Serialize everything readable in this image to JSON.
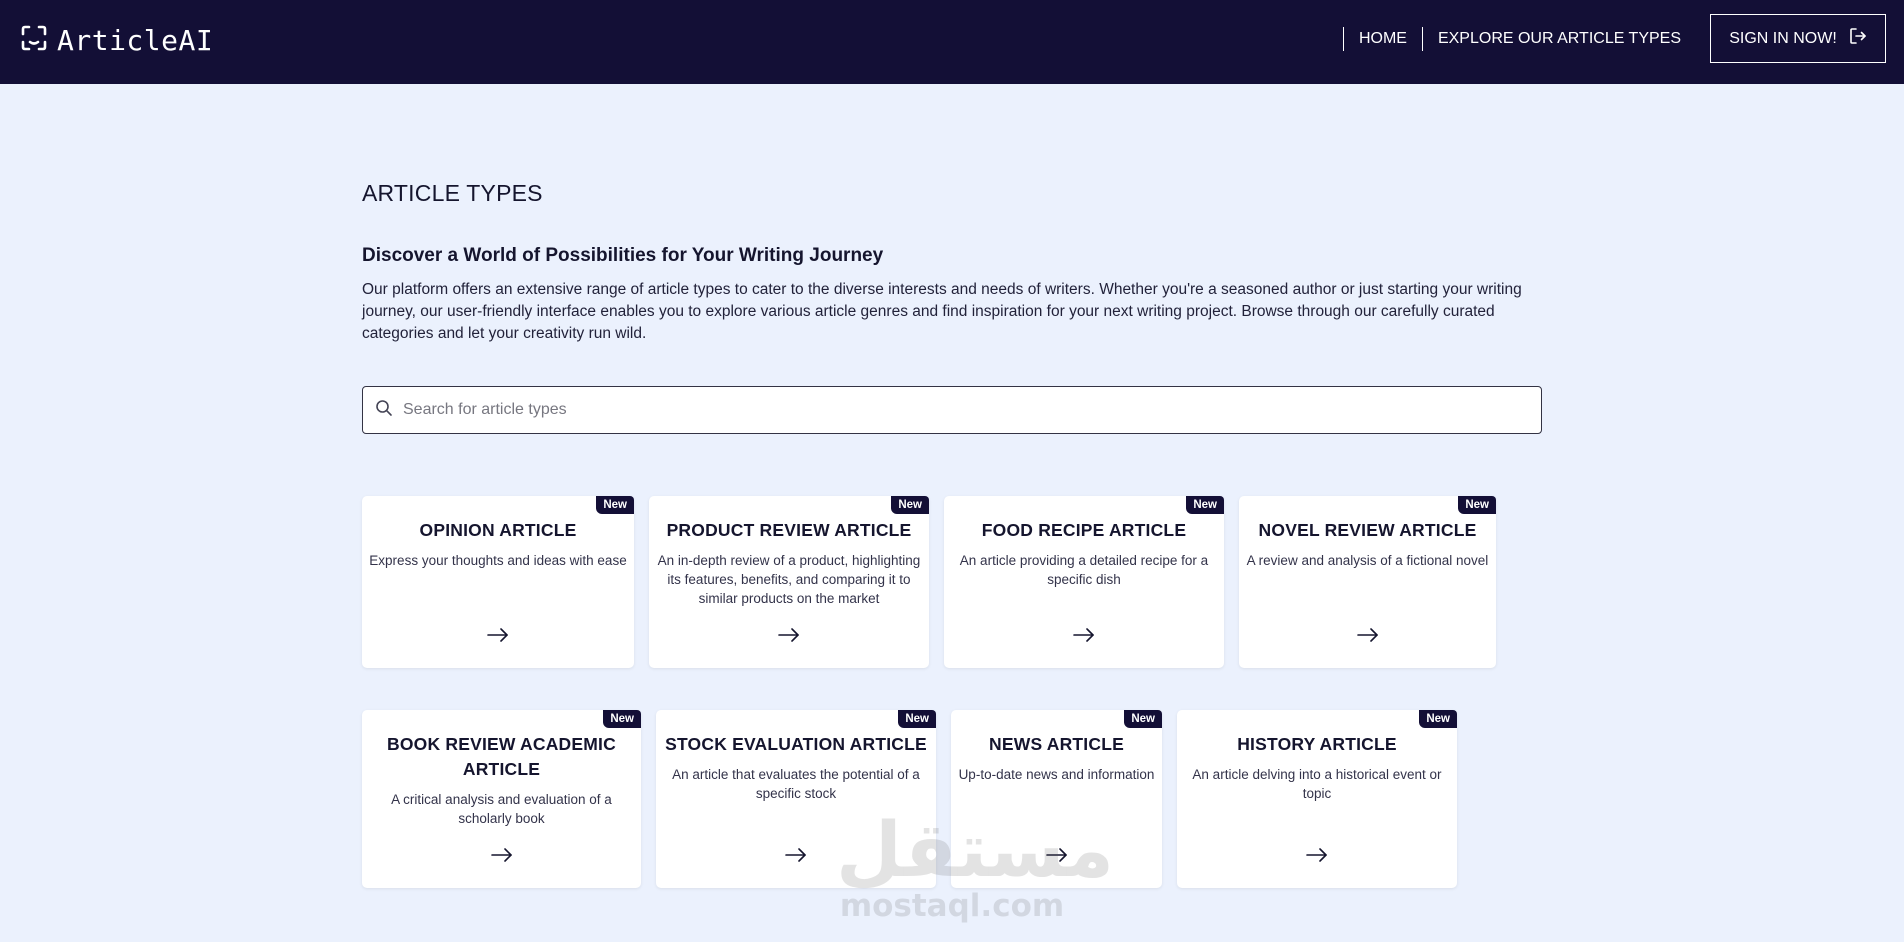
{
  "header": {
    "brand": "ArticleAI",
    "nav": {
      "home": "HOME",
      "explore": "EXPLORE OUR ARTICLE TYPES",
      "signin": "SIGN IN NOW!"
    },
    "colors": {
      "background": "#130f36",
      "text": "#ffffff"
    }
  },
  "main": {
    "title": "ARTICLE TYPES",
    "subtitle": "Discover a World of Possibilities for Your Writing Journey",
    "description": "Our platform offers an extensive range of article types to cater to the diverse interests and needs of writers. Whether you're a seasoned author or just starting your writing journey, our user-friendly interface enables you to explore various article genres and find inspiration for your next writing project. Browse through our carefully curated categories and let your creativity run wild.",
    "search": {
      "placeholder": "Search for article types",
      "value": ""
    },
    "badge_label": "New",
    "cards": [
      {
        "title": "OPINION ARTICLE",
        "description": "Express your thoughts and ideas with ease",
        "badge": "New"
      },
      {
        "title": "PRODUCT REVIEW ARTICLE",
        "description": "An in-depth review of a product, highlighting its features, benefits, and comparing it to similar products on the market",
        "badge": "New"
      },
      {
        "title": "FOOD RECIPE ARTICLE",
        "description": "An article providing a detailed recipe for a specific dish",
        "badge": "New"
      },
      {
        "title": "NOVEL REVIEW ARTICLE",
        "description": "A review and analysis of a fictional novel",
        "badge": "New"
      },
      {
        "title": "BOOK REVIEW ACADEMIC ARTICLE",
        "description": "A critical analysis and evaluation of a scholarly book",
        "badge": "New"
      },
      {
        "title": "STOCK EVALUATION ARTICLE",
        "description": "An article that evaluates the potential of a specific stock",
        "badge": "New"
      },
      {
        "title": "NEWS ARTICLE",
        "description": "Up-to-date news and information",
        "badge": "New"
      },
      {
        "title": "HISTORY ARTICLE",
        "description": "An article delving into a historical event or topic",
        "badge": "New"
      }
    ],
    "colors": {
      "page_background": "#ebf1fd",
      "accent": "#130f36"
    }
  },
  "watermark": {
    "arabic": "مستقل",
    "latin": "mostaql.com"
  }
}
